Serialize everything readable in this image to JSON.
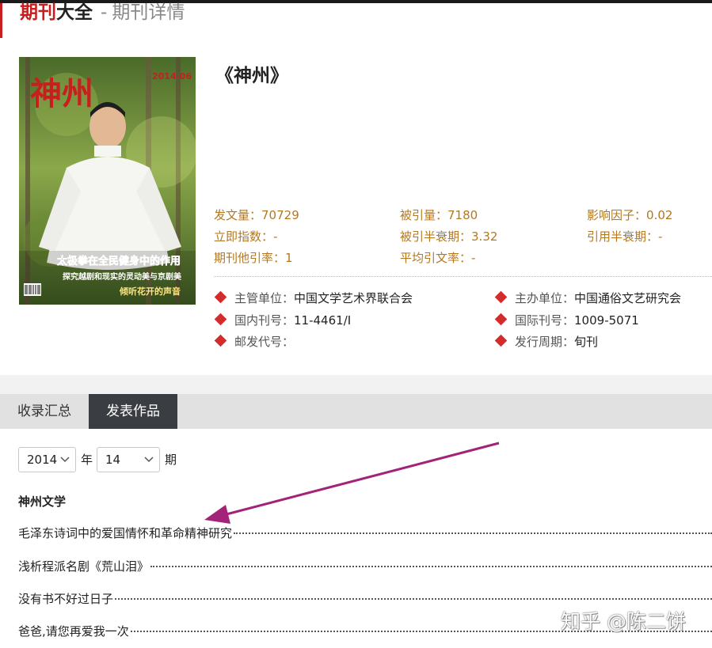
{
  "header": {
    "title_part1": "期刊",
    "title_part2": "大全",
    "separator": "-",
    "subtitle": "期刊详情"
  },
  "journal": {
    "title": "《神州》",
    "cover": {
      "masthead": "神州",
      "issue": "2014·06",
      "headline": "太极拳在全民健身中的作用",
      "line2": "探究越剧和现实的灵动美与京剧美",
      "line3": "倾听花开的声音"
    }
  },
  "stats": [
    {
      "label": "发文量：",
      "value": "70729"
    },
    {
      "label": "被引量：",
      "value": "7180"
    },
    {
      "label": "影响因子：",
      "value": "0.02"
    },
    {
      "label": "立即指数：",
      "value": "-"
    },
    {
      "label": "被引半衰期：",
      "value": "3.32"
    },
    {
      "label": "引用半衰期：",
      "value": "-"
    },
    {
      "label": "期刊他引率：",
      "value": "1"
    },
    {
      "label": "平均引文率：",
      "value": "-"
    }
  ],
  "info": [
    {
      "label": "主管单位：",
      "value": "中国文学艺术界联合会"
    },
    {
      "label": "主办单位：",
      "value": "中国通俗文艺研究会"
    },
    {
      "label": "国内刊号：",
      "value": "11-4461/I"
    },
    {
      "label": "国际刊号：",
      "value": "1009-5071"
    },
    {
      "label": "邮发代号：",
      "value": ""
    },
    {
      "label": "发行周期：",
      "value": "旬刊"
    }
  ],
  "tabs": [
    {
      "label": "收录汇总",
      "active": false
    },
    {
      "label": "发表作品",
      "active": true
    }
  ],
  "filters": {
    "year": "2014",
    "year_unit": "年",
    "issue": "14",
    "issue_unit": "期",
    "chevron": "chevron-down-icon"
  },
  "section_title": "神州文学",
  "articles": [
    {
      "title": "毛泽东诗词中的爱国情怀和革命精神研究"
    },
    {
      "title": "浅析程派名剧《荒山泪》"
    },
    {
      "title": "没有书不好过日子"
    },
    {
      "title": "爸爸,请您再爱我一次"
    }
  ],
  "watermark": "知乎 @陈二饼",
  "colors": {
    "accent_red": "#c81e1e",
    "stat_gold": "#b4781e",
    "diamond_red": "#d22c2c",
    "active_tab": "#3a3d42",
    "arrow": "#a3237a"
  }
}
